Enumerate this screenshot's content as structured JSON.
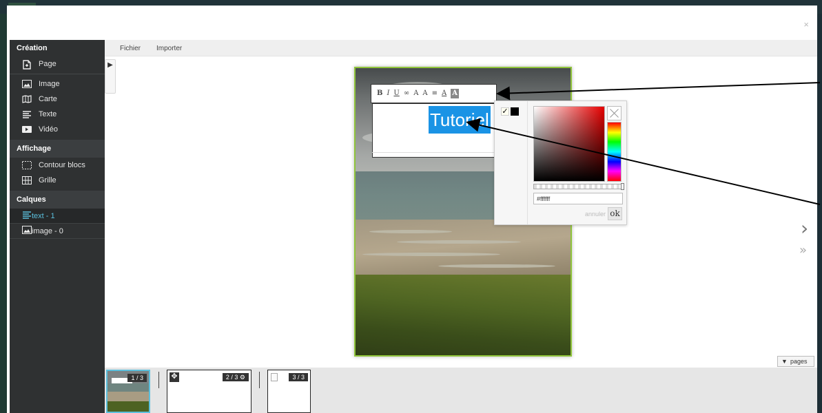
{
  "modal": {
    "close_label": "×"
  },
  "sidebar": {
    "creation": {
      "title": "Création",
      "items": [
        {
          "label": "Page",
          "icon": "new-page-icon"
        },
        {
          "label": "Image",
          "icon": "image-icon"
        },
        {
          "label": "Carte",
          "icon": "map-icon"
        },
        {
          "label": "Texte",
          "icon": "text-icon"
        },
        {
          "label": "Vidéo",
          "icon": "video-icon"
        }
      ]
    },
    "affichage": {
      "title": "Affichage",
      "items": [
        {
          "label": "Contour blocs",
          "icon": "dotted-border-icon"
        },
        {
          "label": "Grille",
          "icon": "grid-icon"
        }
      ]
    },
    "calques": {
      "title": "Calques",
      "items": [
        {
          "label": "text - 1",
          "icon": "text-icon",
          "active": true
        },
        {
          "label": "image - 0",
          "icon": "image-icon",
          "active": false
        }
      ]
    }
  },
  "menubar": {
    "file_label": "Fichier",
    "import_label": "Importer"
  },
  "editor": {
    "text_content": "Tutoriel",
    "toolbar": {
      "bold": "B",
      "italic": "I",
      "underline": "U",
      "link": "∞",
      "font_size": "A",
      "font": "A",
      "align": "≡",
      "color": "A",
      "background": "A"
    }
  },
  "color_picker": {
    "hex_value": "#ffffff",
    "cancel_label": "annuler",
    "ok_label": "ok",
    "hue_color": "#e60000"
  },
  "navigation": {
    "next": "›",
    "last": "»",
    "pages_label": "pages"
  },
  "thumbnails": [
    {
      "label": "1 / 3"
    },
    {
      "label": "2 / 3"
    },
    {
      "label": "3 / 3"
    }
  ],
  "colors": {
    "accent": "#5bc0de",
    "selection": "#1a93e5",
    "page_border": "#8fc43a",
    "sidebar_bg": "#2f3132"
  }
}
